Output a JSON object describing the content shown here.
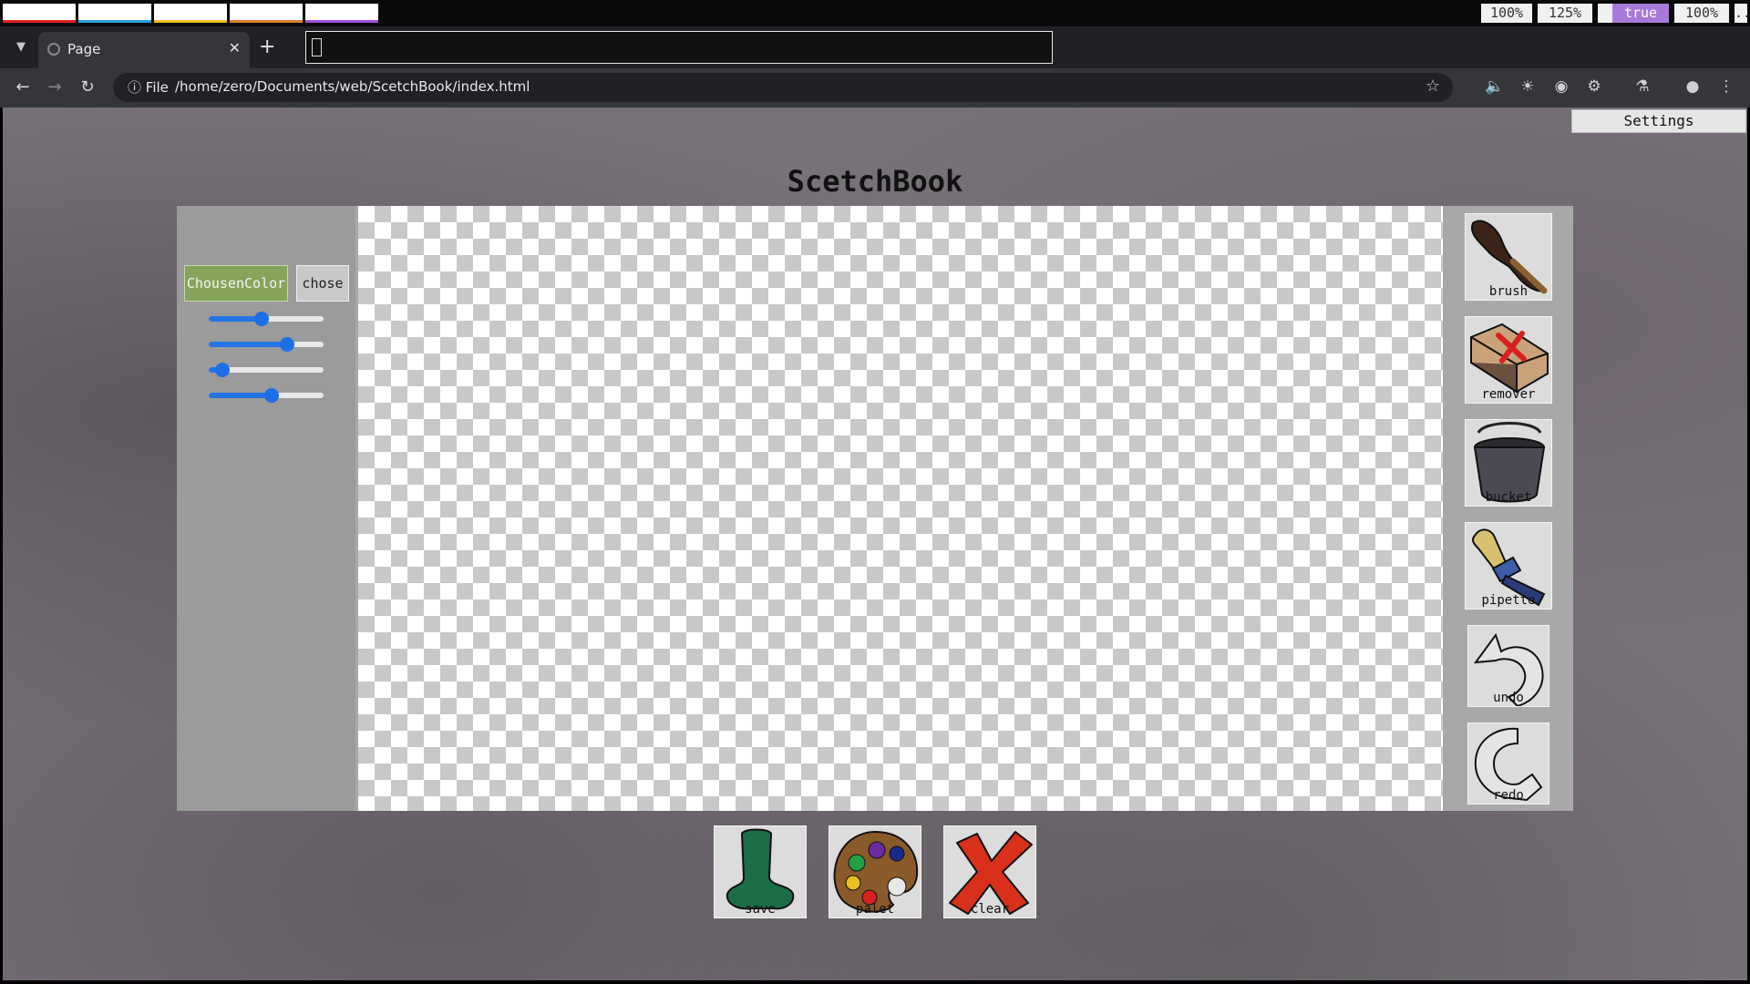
{
  "system_bar": {
    "workspaces": [
      {
        "accent": "#e02020"
      },
      {
        "accent": "#2aa0e0"
      },
      {
        "accent": "#e8c020"
      },
      {
        "accent": "#e08030"
      },
      {
        "accent": "#a050e0"
      }
    ],
    "indicators": [
      "100%",
      "125%",
      "true",
      "100%",
      "..."
    ]
  },
  "browser": {
    "tab_title": "Page",
    "address_scheme": "File",
    "url": "/home/zero/Documents/web/ScetchBook/index.html"
  },
  "app": {
    "settings_label": "Settings",
    "title": "ScetchBook",
    "color_button_label": "ChousenColor",
    "chose_button_label": "chose",
    "sliders": [
      0.46,
      0.68,
      0.12,
      0.55
    ],
    "tools": [
      {
        "label": "brush",
        "icon": "brush-icon"
      },
      {
        "label": "remover",
        "icon": "eraser-icon"
      },
      {
        "label": "bucket",
        "icon": "bucket-icon"
      },
      {
        "label": "pipette",
        "icon": "pipette-icon"
      },
      {
        "label": "undo",
        "icon": "undo-icon"
      },
      {
        "label": "redo",
        "icon": "redo-icon"
      }
    ],
    "actions": [
      {
        "label": "save",
        "icon": "save-icon"
      },
      {
        "label": "palet",
        "icon": "palette-icon"
      },
      {
        "label": "clear",
        "icon": "clear-icon"
      }
    ]
  },
  "colors": {
    "accent_green": "#86a55a",
    "slider_blue": "#1c6fe8"
  }
}
